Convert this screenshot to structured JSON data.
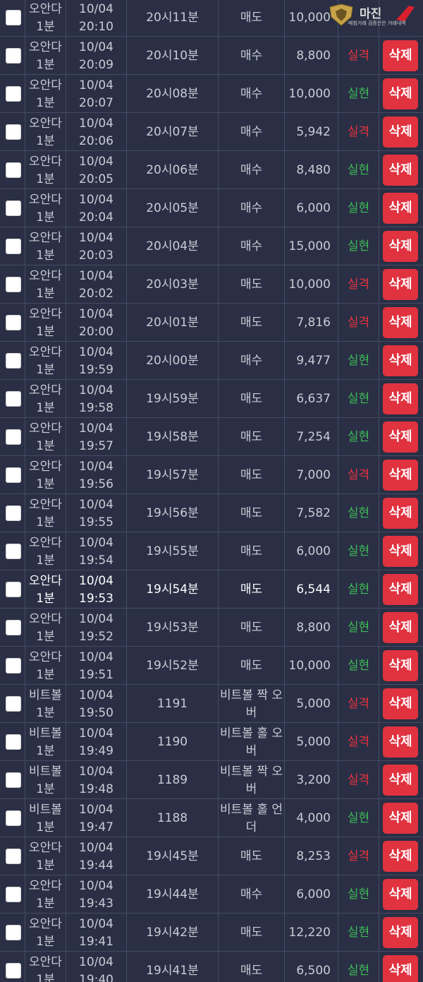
{
  "watermark": {
    "title": "마진",
    "subtitle": "매칭거래 검증은은 거래내역"
  },
  "delete_label": "삭제",
  "rows": [
    {
      "game": [
        "오안다",
        "1분"
      ],
      "time": [
        "10/04",
        "20:10"
      ],
      "round": "20시11분",
      "pick": "매도",
      "amount": "10,000",
      "result": "",
      "result_type": "",
      "first": true
    },
    {
      "game": [
        "오안다",
        "1분"
      ],
      "time": [
        "10/04",
        "20:09"
      ],
      "round": "20시10분",
      "pick": "매수",
      "amount": "8,800",
      "result": "실격",
      "result_type": "fail"
    },
    {
      "game": [
        "오안다",
        "1분"
      ],
      "time": [
        "10/04",
        "20:07"
      ],
      "round": "20시08분",
      "pick": "매수",
      "amount": "10,000",
      "result": "실현",
      "result_type": "win"
    },
    {
      "game": [
        "오안다",
        "1분"
      ],
      "time": [
        "10/04",
        "20:06"
      ],
      "round": "20시07분",
      "pick": "매수",
      "amount": "5,942",
      "result": "실격",
      "result_type": "fail"
    },
    {
      "game": [
        "오안다",
        "1분"
      ],
      "time": [
        "10/04",
        "20:05"
      ],
      "round": "20시06분",
      "pick": "매수",
      "amount": "8,480",
      "result": "실현",
      "result_type": "win"
    },
    {
      "game": [
        "오안다",
        "1분"
      ],
      "time": [
        "10/04",
        "20:04"
      ],
      "round": "20시05분",
      "pick": "매수",
      "amount": "6,000",
      "result": "실현",
      "result_type": "win"
    },
    {
      "game": [
        "오안다",
        "1분"
      ],
      "time": [
        "10/04",
        "20:03"
      ],
      "round": "20시04분",
      "pick": "매수",
      "amount": "15,000",
      "result": "실현",
      "result_type": "win"
    },
    {
      "game": [
        "오안다",
        "1분"
      ],
      "time": [
        "10/04",
        "20:02"
      ],
      "round": "20시03분",
      "pick": "매도",
      "amount": "10,000",
      "result": "실격",
      "result_type": "fail"
    },
    {
      "game": [
        "오안다",
        "1분"
      ],
      "time": [
        "10/04",
        "20:00"
      ],
      "round": "20시01분",
      "pick": "매도",
      "amount": "7,816",
      "result": "실격",
      "result_type": "fail"
    },
    {
      "game": [
        "오안다",
        "1분"
      ],
      "time": [
        "10/04",
        "19:59"
      ],
      "round": "20시00분",
      "pick": "매수",
      "amount": "9,477",
      "result": "실현",
      "result_type": "win"
    },
    {
      "game": [
        "오안다",
        "1분"
      ],
      "time": [
        "10/04",
        "19:58"
      ],
      "round": "19시59분",
      "pick": "매도",
      "amount": "6,637",
      "result": "실현",
      "result_type": "win"
    },
    {
      "game": [
        "오안다",
        "1분"
      ],
      "time": [
        "10/04",
        "19:57"
      ],
      "round": "19시58분",
      "pick": "매도",
      "amount": "7,254",
      "result": "실현",
      "result_type": "win"
    },
    {
      "game": [
        "오안다",
        "1분"
      ],
      "time": [
        "10/04",
        "19:56"
      ],
      "round": "19시57분",
      "pick": "매도",
      "amount": "7,000",
      "result": "실격",
      "result_type": "fail"
    },
    {
      "game": [
        "오안다",
        "1분"
      ],
      "time": [
        "10/04",
        "19:55"
      ],
      "round": "19시56분",
      "pick": "매도",
      "amount": "7,582",
      "result": "실현",
      "result_type": "win"
    },
    {
      "game": [
        "오안다",
        "1분"
      ],
      "time": [
        "10/04",
        "19:54"
      ],
      "round": "19시55분",
      "pick": "매도",
      "amount": "6,000",
      "result": "실현",
      "result_type": "win"
    },
    {
      "game": [
        "오안다",
        "1분"
      ],
      "time": [
        "10/04",
        "19:53"
      ],
      "round": "19시54분",
      "pick": "매도",
      "amount": "6,544",
      "result": "실현",
      "result_type": "win",
      "highlight": true
    },
    {
      "game": [
        "오안다",
        "1분"
      ],
      "time": [
        "10/04",
        "19:52"
      ],
      "round": "19시53분",
      "pick": "매도",
      "amount": "8,800",
      "result": "실현",
      "result_type": "win"
    },
    {
      "game": [
        "오안다",
        "1분"
      ],
      "time": [
        "10/04",
        "19:51"
      ],
      "round": "19시52분",
      "pick": "매도",
      "amount": "10,000",
      "result": "실현",
      "result_type": "win"
    },
    {
      "game": [
        "비트볼",
        "1분"
      ],
      "time": [
        "10/04",
        "19:50"
      ],
      "round": "1191",
      "pick": "비트볼 짝 오버",
      "amount": "5,000",
      "result": "실격",
      "result_type": "fail"
    },
    {
      "game": [
        "비트볼",
        "1분"
      ],
      "time": [
        "10/04",
        "19:49"
      ],
      "round": "1190",
      "pick": "비트볼 홀 오버",
      "amount": "5,000",
      "result": "실격",
      "result_type": "fail"
    },
    {
      "game": [
        "비트볼",
        "1분"
      ],
      "time": [
        "10/04",
        "19:48"
      ],
      "round": "1189",
      "pick": "비트볼 짝 오버",
      "amount": "3,200",
      "result": "실격",
      "result_type": "fail"
    },
    {
      "game": [
        "비트볼",
        "1분"
      ],
      "time": [
        "10/04",
        "19:47"
      ],
      "round": "1188",
      "pick": "비트볼 홀 언더",
      "amount": "4,000",
      "result": "실현",
      "result_type": "win"
    },
    {
      "game": [
        "오안다",
        "1분"
      ],
      "time": [
        "10/04",
        "19:44"
      ],
      "round": "19시45분",
      "pick": "매도",
      "amount": "8,253",
      "result": "실격",
      "result_type": "fail"
    },
    {
      "game": [
        "오안다",
        "1분"
      ],
      "time": [
        "10/04",
        "19:43"
      ],
      "round": "19시44분",
      "pick": "매수",
      "amount": "6,000",
      "result": "실현",
      "result_type": "win"
    },
    {
      "game": [
        "오안다",
        "1분"
      ],
      "time": [
        "10/04",
        "19:41"
      ],
      "round": "19시42분",
      "pick": "매도",
      "amount": "12,220",
      "result": "실현",
      "result_type": "win"
    },
    {
      "game": [
        "오안다",
        "1분"
      ],
      "time": [
        "10/04",
        "19:40"
      ],
      "round": "19시41분",
      "pick": "매도",
      "amount": "6,500",
      "result": "실현",
      "result_type": "win"
    }
  ]
}
